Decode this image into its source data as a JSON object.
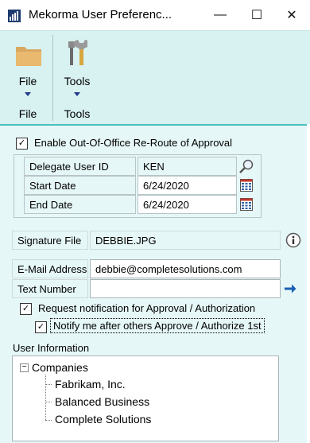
{
  "window": {
    "title": "Mekorma User Preferenc...",
    "minimize": "—",
    "maximize": "☐",
    "close": "✕"
  },
  "ribbon": {
    "file_button": "File",
    "file_group": "File",
    "tools_button": "Tools",
    "tools_group": "Tools"
  },
  "out_of_office": {
    "label": "Enable Out-Of-Office Re-Route of Approval",
    "checked": true,
    "delegate_label": "Delegate User ID",
    "delegate_value": "KEN",
    "start_label": "Start Date",
    "start_value": "6/24/2020",
    "end_label": "End Date",
    "end_value": "6/24/2020"
  },
  "signature": {
    "label": "Signature File",
    "value": "DEBBIE.JPG"
  },
  "email": {
    "label": "E-Mail Address",
    "value": "debbie@completesolutions.com"
  },
  "text_number": {
    "label": "Text Number",
    "value": ""
  },
  "notifications": {
    "request_label": "Request notification for Approval / Authorization",
    "request_checked": true,
    "notify_label": "Notify me after others Approve / Authorize 1st",
    "notify_checked": true
  },
  "user_information": {
    "label": "User Information",
    "root": "Companies",
    "root_toggle": "−",
    "companies": [
      "Fabrikam, Inc.",
      "Balanced Business",
      "Complete Solutions"
    ]
  },
  "colors": {
    "ribbon_bg": "#d8f1f1",
    "content_bg": "#e6f7f7",
    "accent": "#4bbfc0",
    "arrow_blue": "#1a5fb4"
  },
  "icons": [
    "app-logo-icon",
    "folder-icon",
    "tools-icon",
    "lookup-icon",
    "calendar-icon",
    "info-icon",
    "arrow-right-icon"
  ]
}
